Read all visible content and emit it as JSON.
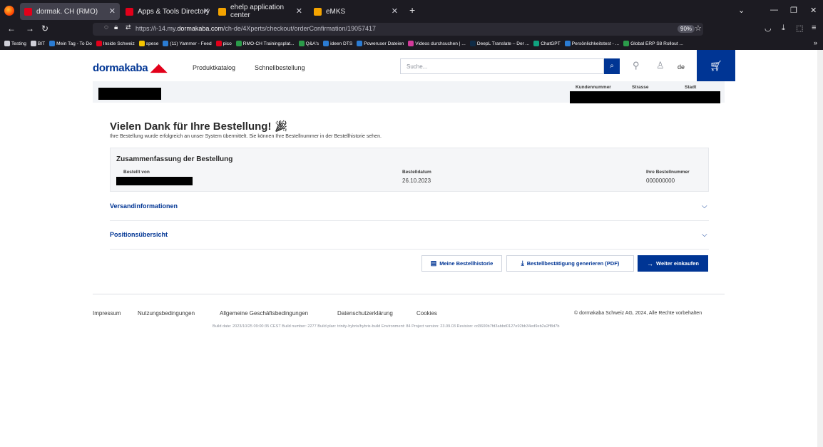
{
  "browser": {
    "tabs": [
      {
        "label": "dormak. CH (RMO)",
        "color": "#e2001a"
      },
      {
        "label": "Apps & Tools Directory",
        "color": "#e2001a"
      },
      {
        "label": "ehelp application center",
        "color": "#f4a400"
      },
      {
        "label": "eMKS",
        "color": "#f4a400"
      }
    ],
    "url_prefix": "https://i-14.my.",
    "url_domain": "dormakaba.com",
    "url_suffix": "/ch-de/4Xperts/checkout/orderConfirmation/19057417",
    "zoom": "90%",
    "bookmarks": [
      {
        "label": "Testing",
        "color": "#cfcfd8"
      },
      {
        "label": "BIT",
        "color": "#cfcfd8"
      },
      {
        "label": "Mein Tag - To Do",
        "color": "#2b7cd3"
      },
      {
        "label": "Inside Schweiz",
        "color": "#e2001a"
      },
      {
        "label": "spese",
        "color": "#f4c400"
      },
      {
        "label": "(11) Yammer - Feed",
        "color": "#2b7cd3"
      },
      {
        "label": "pico",
        "color": "#e2001a"
      },
      {
        "label": "RMO-CH Trainingsplat...",
        "color": "#2b9b4a"
      },
      {
        "label": "Q&A's",
        "color": "#2b9b4a"
      },
      {
        "label": "ideen DTS",
        "color": "#2b7cd3"
      },
      {
        "label": "Poweruser Dateien",
        "color": "#2b7cd3"
      },
      {
        "label": "Videos durchsuchen | ...",
        "color": "#d33a9b"
      },
      {
        "label": "DeepL Translate – Der ...",
        "color": "#0f2b46"
      },
      {
        "label": "ChatGPT",
        "color": "#10a37f"
      },
      {
        "label": "Persönlichkeitstest - ...",
        "color": "#2b7cd3"
      },
      {
        "label": "Global ERP S8 Rollout ...",
        "color": "#2b9b4a"
      }
    ]
  },
  "site": {
    "logo_text": "dormakaba",
    "nav": [
      "Produktkatalog",
      "Schnellbestellung"
    ],
    "search_placeholder": "Suche...",
    "lang": "de"
  },
  "customer": {
    "labels": [
      "Kundennummer",
      "Strasse",
      "Stadt"
    ]
  },
  "confirmation": {
    "title": "Vielen Dank für Ihre Bestellung!",
    "subtitle": "Ihre Bestellung wurde erfolgreich an unser System übermittelt. Sie können Ihre Bestellnummer in der Bestellhistorie sehen.",
    "summary_title": "Zusammenfassung der Bestellung",
    "ordered_by_label": "Bestellt von",
    "date_label": "Bestelldatum",
    "date_value": "26.10.2023",
    "order_no_label": "Ihre Bestellnummer",
    "order_no_value": "000000000",
    "sections": [
      "Versandinformationen",
      "Positionsübersicht"
    ],
    "buttons": {
      "history": "Meine Bestellhistorie",
      "pdf": "Bestellbestätigung generieren (PDF)",
      "continue": "Weiter einkaufen"
    }
  },
  "footer": {
    "links": [
      "Impressum",
      "Nutzungsbedingungen",
      "Allgemeine Geschäftsbedingungen",
      "Datenschutzerklärung",
      "Cookies"
    ],
    "copyright": "© dormakaba Schweiz AG, 2024, Alle Rechte vorbehalten",
    "build": "Build date: 2023/10/25 09:00:35 CEST Build number: 2277 Build plan: trinity-hybris/hybris-build Environment: 84 Project version: 23.09.03 Revision: cd3600b7fd3abbd0127e92bb34ed9eb2a2ff8d7b"
  }
}
